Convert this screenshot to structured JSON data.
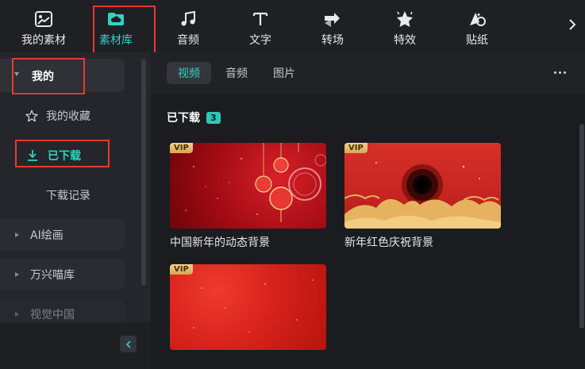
{
  "toolbar": {
    "tools": [
      {
        "label": "我的素材",
        "icon": "media-library-icon"
      },
      {
        "label": "素材库",
        "icon": "cloud-folder-icon",
        "active": true
      },
      {
        "label": "音频",
        "icon": "music-note-icon"
      },
      {
        "label": "文字",
        "icon": "text-t-icon"
      },
      {
        "label": "转场",
        "icon": "transition-arrows-icon"
      },
      {
        "label": "特效",
        "icon": "sparkle-star-icon"
      },
      {
        "label": "贴纸",
        "icon": "sticker-icon"
      }
    ],
    "more_icon": "chevron-right-icon"
  },
  "sidebar": {
    "header_label": "我的",
    "favorites_label": "我的收藏",
    "downloaded_label": "已下载",
    "history_label": "下载记录",
    "groups": [
      "AI绘画",
      "万兴喵库",
      "视觉中国"
    ]
  },
  "main": {
    "tabs": [
      "视频",
      "音频",
      "图片"
    ],
    "active_tab": "视频",
    "section_title": "已下载",
    "count": "3",
    "vip_label": "VIP",
    "cards": [
      {
        "title": "中国新年的动态背景"
      },
      {
        "title": "新年红色庆祝背景"
      },
      {
        "title": ""
      }
    ]
  },
  "colors": {
    "accent": "#33d1c2",
    "highlight": "#e53935",
    "vip_gold": "#e8c06f"
  }
}
